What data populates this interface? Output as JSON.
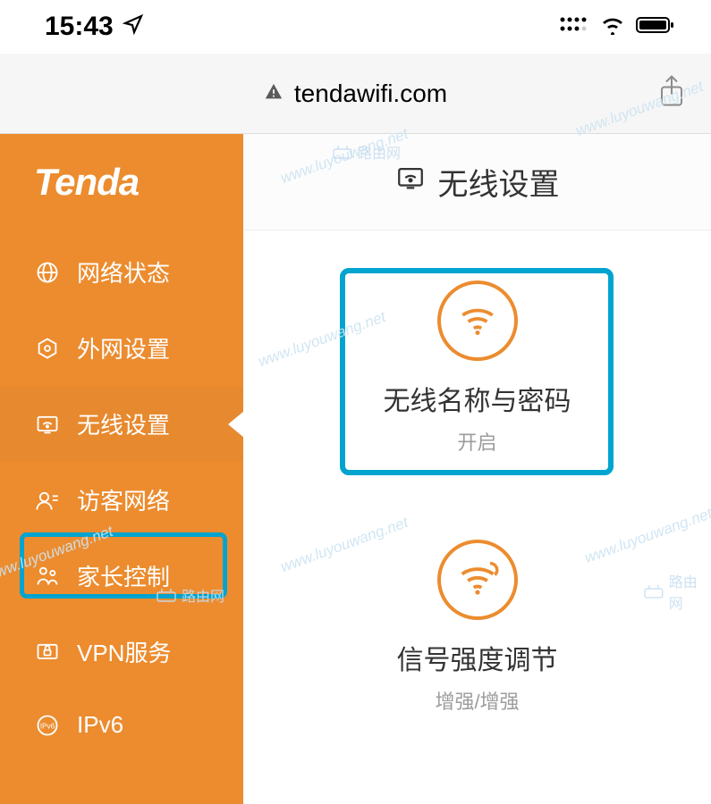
{
  "status": {
    "time": "15:43"
  },
  "browser": {
    "url": "tendawifi.com"
  },
  "brand": "Tenda",
  "page": {
    "title": "无线设置"
  },
  "sidebar": {
    "items": [
      {
        "label": "网络状态",
        "icon": "globe-icon"
      },
      {
        "label": "外网设置",
        "icon": "hexagon-icon"
      },
      {
        "label": "无线设置",
        "icon": "monitor-wifi-icon",
        "active": true
      },
      {
        "label": "访客网络",
        "icon": "guest-icon"
      },
      {
        "label": "家长控制",
        "icon": "parental-icon"
      },
      {
        "label": "VPN服务",
        "icon": "vpn-icon"
      },
      {
        "label": "IPv6",
        "icon": "ipv6-icon"
      }
    ]
  },
  "cards": {
    "wifi_name": {
      "title": "无线名称与密码",
      "status": "开启"
    },
    "signal": {
      "title": "信号强度调节",
      "status": "增强/增强"
    }
  },
  "watermark": {
    "text": "www.luyouwang.net",
    "badge": "路由网"
  }
}
